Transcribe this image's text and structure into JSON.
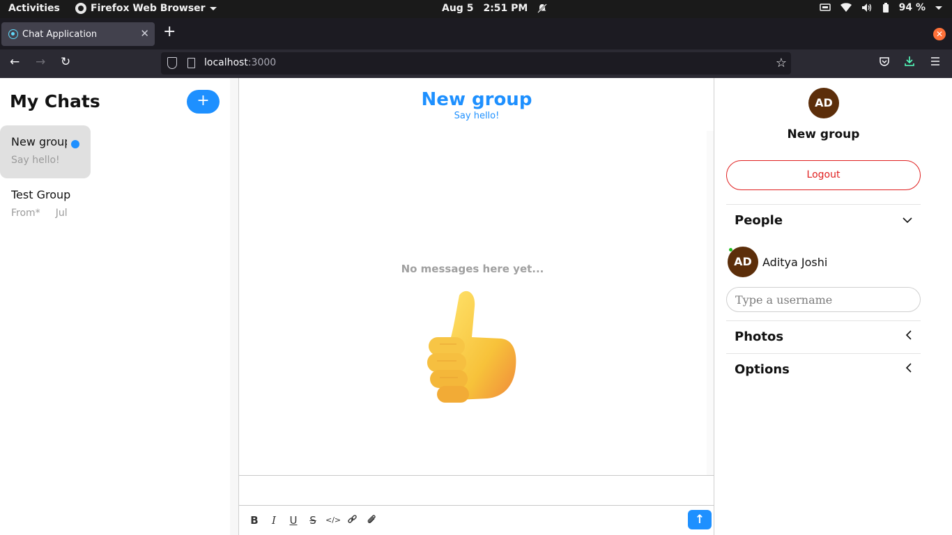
{
  "os_bar": {
    "activities": "Activities",
    "app_name": "Firefox Web Browser",
    "date": "Aug 5",
    "time": "2:51 PM",
    "battery": "94 %"
  },
  "browser": {
    "tab_title": "Chat Application",
    "url_host": "localhost",
    "url_port": ":3000"
  },
  "left_panel": {
    "title": "My Chats",
    "add_label": "+",
    "chats": [
      {
        "name": "New group",
        "preview": "Say hello!",
        "time": "",
        "unread": true
      },
      {
        "name": "Test Group",
        "preview": "From*",
        "time": "Jul",
        "unread": false
      }
    ]
  },
  "chat": {
    "title": "New group",
    "subtitle": "Say hello!",
    "empty_text": "No messages here yet...",
    "empty_icon": "thumbs-up-emoji",
    "toolbar": [
      "bold-icon",
      "italic-icon",
      "underline-icon",
      "strikethrough-icon",
      "code-icon",
      "link-icon",
      "attachment-icon"
    ],
    "send_icon": "arrow-up-icon"
  },
  "right_panel": {
    "avatar_initials": "AD",
    "title": "New group",
    "logout_label": "Logout",
    "people_label": "People",
    "people": [
      {
        "initials": "AD",
        "name": "Aditya Joshi",
        "online": true
      }
    ],
    "username_placeholder": "Type a username",
    "photos_label": "Photos",
    "options_label": "Options"
  },
  "colors": {
    "accent": "#1e90ff",
    "danger": "#e01e1e",
    "avatar": "#5c2e0a",
    "online": "#1fc01f"
  }
}
